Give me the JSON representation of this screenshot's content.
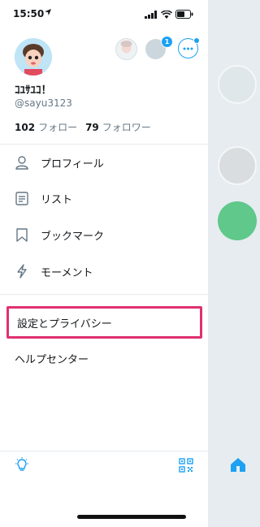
{
  "status_bar": {
    "time": "15:50"
  },
  "profile": {
    "display_name": "ｺﾕｻﾕｺ！",
    "handle": "@sayu3123",
    "following_count": "102",
    "following_label": "フォロー",
    "followers_count": "79",
    "followers_label": "フォロワー",
    "notification_badge": "1"
  },
  "menu": {
    "items": [
      {
        "label": "プロフィール",
        "icon": "person-icon"
      },
      {
        "label": "リスト",
        "icon": "list-icon"
      },
      {
        "label": "ブックマーク",
        "icon": "bookmark-icon"
      },
      {
        "label": "モーメント",
        "icon": "lightning-icon"
      }
    ],
    "settings_label": "設定とプライバシー",
    "help_label": "ヘルプセンター"
  },
  "colors": {
    "accent": "#1da1f2",
    "highlight": "#e0306f",
    "secondary_text": "#657786"
  }
}
